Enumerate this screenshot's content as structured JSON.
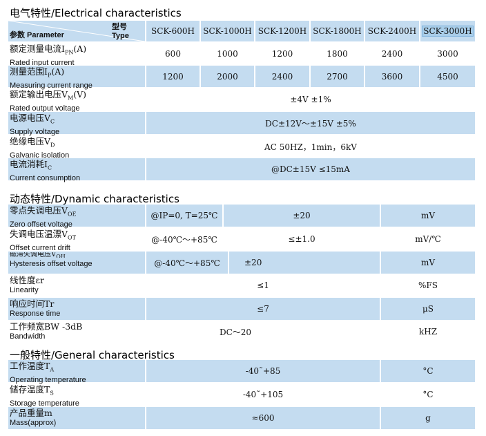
{
  "sections": {
    "electrical": "电气特性/Electrical characteristics",
    "dynamic": "动态特性/Dynamic characteristics",
    "general": "一般特性/General characteristics"
  },
  "header": {
    "type_label": "型号 Type",
    "param_label": "参数 Parameter",
    "models": [
      "SCK-600H",
      "SCK-1000H",
      "SCK-1200H",
      "SCK-1800H",
      "SCK-2400H",
      "SCK-3000H"
    ]
  },
  "electrical": {
    "rated_input": {
      "zh": "额定测量电流I",
      "sub": "PN",
      "zh_tail": "(A)",
      "en": "Rated input current",
      "values": [
        "600",
        "1000",
        "1200",
        "1800",
        "2400",
        "3000"
      ]
    },
    "measuring_range": {
      "zh": "测量范围I",
      "sub": "P",
      "zh_tail": "(A)",
      "en": "Measuring current range",
      "values": [
        "1200",
        "2000",
        "2400",
        "2700",
        "3600",
        "4500"
      ]
    },
    "rated_output": {
      "zh": "额定输出电压V",
      "sub": "M",
      "zh_tail": "(V)",
      "en": "Rated output voltage",
      "value": "±4V  ±1%"
    },
    "supply": {
      "zh": "电源电压V",
      "sub": "C",
      "zh_tail": "",
      "en": "Supply voltage",
      "value": "DC±12V～±15V  ±5%"
    },
    "isolation": {
      "zh": "绝缘电压V",
      "sub": "D",
      "zh_tail": "",
      "en": "Galvanic isolation",
      "value": "AC  50HZ，1min，6kV"
    },
    "consumption": {
      "zh": "电流消耗I",
      "sub": "C",
      "zh_tail": "",
      "en": "Current consumption",
      "value": "@DC±15V   ≤15mA"
    }
  },
  "dynamic": {
    "zero_offset": {
      "zh": "零点失调电压V",
      "sub": "OE",
      "en": "Zero offset voltage",
      "cond": "@IP=0,  T=25℃",
      "value": "±20",
      "unit": "mV"
    },
    "offset_drift": {
      "zh": "失调电压温漂V",
      "sub": "OT",
      "en": "Offset current drift",
      "cond": "@-40℃～+85℃",
      "value": "≤±1.0",
      "unit": "mV/℃"
    },
    "hysteresis": {
      "zh": "磁滞失调电压V",
      "sub": "OH",
      "en": "Hysteresis offset voltage",
      "cond": "@-40℃～+85℃",
      "value": "±20",
      "unit": "mV"
    },
    "linearity": {
      "zh": "线性度εr",
      "en": "Linearity",
      "value": "≤1",
      "unit": "%FS"
    },
    "response": {
      "zh": "响应时间Tr",
      "en": "Response time",
      "value": "≤7",
      "unit": "μS"
    },
    "bandwidth": {
      "zh": "工作频宽BW -3dB",
      "en": "Bandwidth",
      "value": "DC～20",
      "unit": "kHZ"
    }
  },
  "general": {
    "operating": {
      "zh": "工作温度T",
      "sub": "A",
      "en": "Operating temperature",
      "value": "-40˜+85",
      "unit": "°C"
    },
    "storage": {
      "zh": "储存温度T",
      "sub": "S",
      "en": "Storage temperature",
      "value": "-40˜+105",
      "unit": "°C"
    },
    "mass": {
      "zh": "产品重量m",
      "en": "Mass(approx)",
      "value": "≈600",
      "unit": "g"
    }
  },
  "colors": {
    "row_fill": "#c4dcf0",
    "selected_model": "#a8cde9"
  }
}
